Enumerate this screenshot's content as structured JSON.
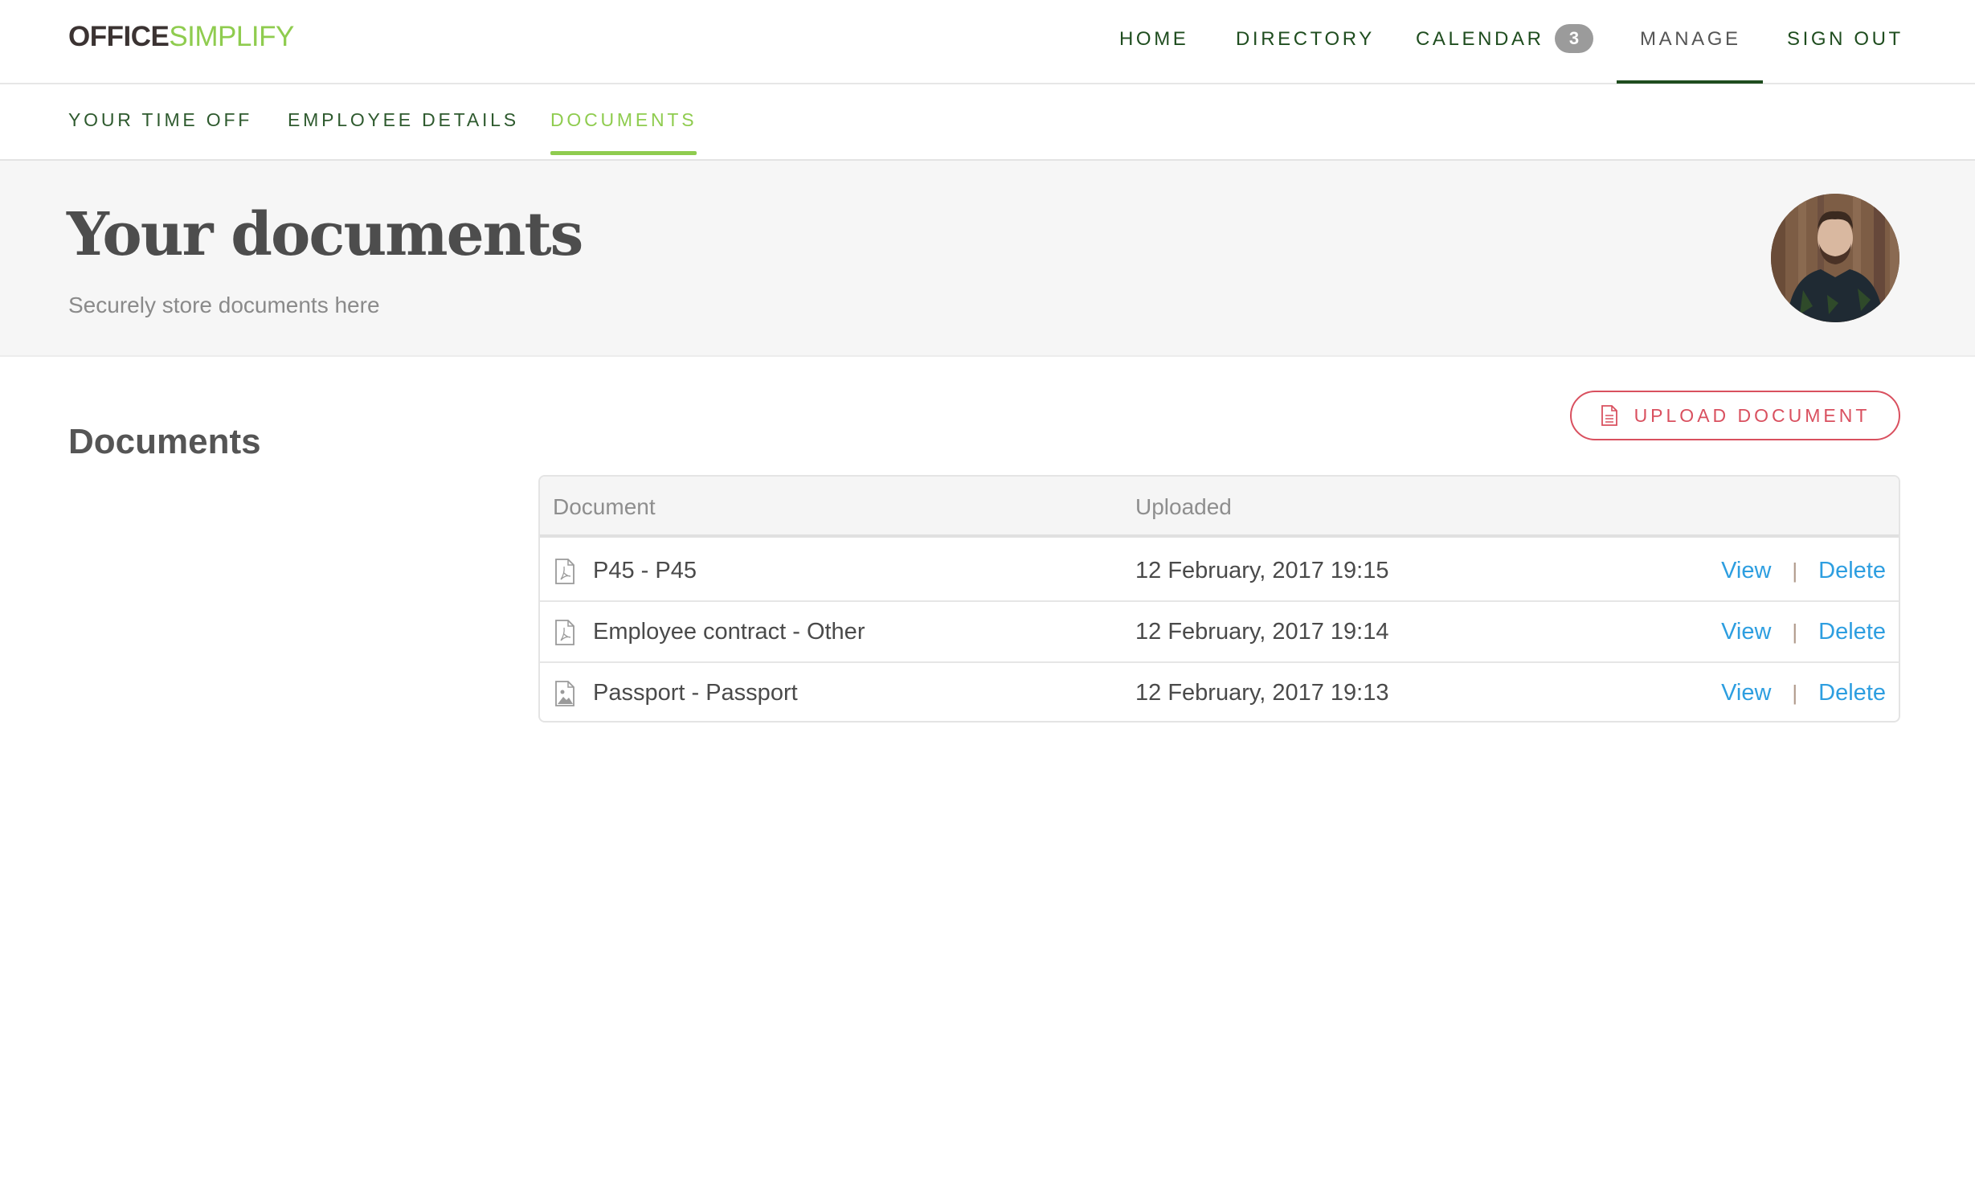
{
  "brand": {
    "part1": "OFFICE",
    "part2": "SIMPLIFY",
    "color_dark": "#3b3332",
    "color_green": "#8fcc4f"
  },
  "topnav": {
    "items": [
      {
        "label": "HOME"
      },
      {
        "label": "DIRECTORY"
      },
      {
        "label": "CALENDAR",
        "badge": "3"
      },
      {
        "label": "MANAGE",
        "active": true
      },
      {
        "label": "SIGN OUT"
      }
    ]
  },
  "subnav": {
    "items": [
      {
        "label": "YOUR TIME OFF"
      },
      {
        "label": "EMPLOYEE DETAILS"
      },
      {
        "label": "DOCUMENTS",
        "active": true
      }
    ]
  },
  "hero": {
    "title": "Your documents",
    "subtitle": "Securely store documents here",
    "avatar_icon": "user-avatar-photo"
  },
  "main": {
    "section_title": "Documents",
    "upload_button": {
      "label": "UPLOAD DOCUMENT",
      "icon": "document-icon",
      "color": "#d9505f"
    },
    "table": {
      "columns": [
        "Document",
        "Uploaded"
      ],
      "rows": [
        {
          "icon": "pdf-file-icon",
          "name": "P45 - P45",
          "uploaded": "12 February, 2017 19:15",
          "view": "View",
          "delete": "Delete"
        },
        {
          "icon": "pdf-file-icon",
          "name": "Employee contract - Other",
          "uploaded": "12 February, 2017 19:14",
          "view": "View",
          "delete": "Delete"
        },
        {
          "icon": "image-file-icon",
          "name": "Passport - Passport",
          "uploaded": "12 February, 2017 19:13",
          "view": "View",
          "delete": "Delete"
        }
      ],
      "separator": "|",
      "link_color": "#2d9ee0"
    }
  }
}
